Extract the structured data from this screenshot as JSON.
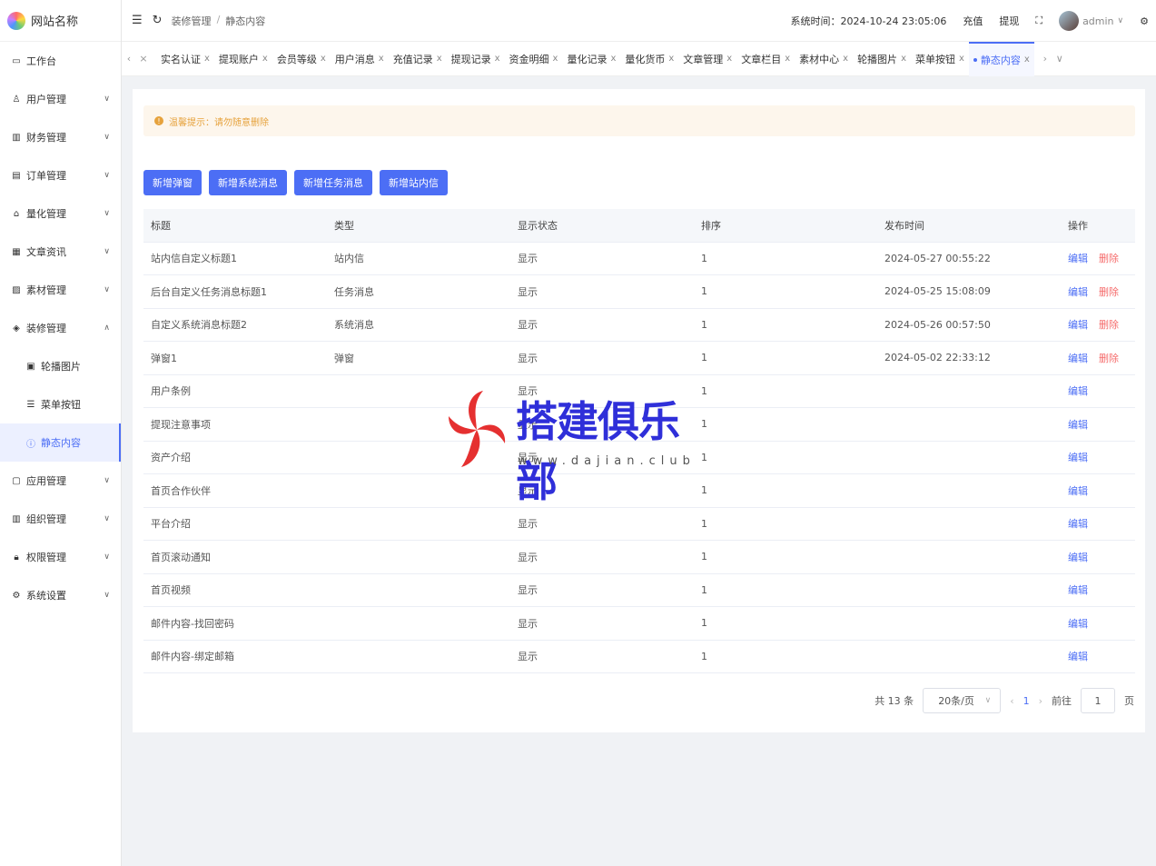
{
  "sidebar": {
    "site_name": "网站名称",
    "items": [
      {
        "label": "工作台",
        "icon": "monitor-icon"
      },
      {
        "label": "用户管理",
        "icon": "user-icon"
      },
      {
        "label": "财务管理",
        "icon": "chart-icon"
      },
      {
        "label": "订单管理",
        "icon": "order-icon"
      },
      {
        "label": "量化管理",
        "icon": "quant-icon"
      },
      {
        "label": "文章资讯",
        "icon": "article-icon"
      },
      {
        "label": "素材管理",
        "icon": "image-icon"
      },
      {
        "label": "装修管理",
        "icon": "decor-icon"
      },
      {
        "label": "轮播图片",
        "icon": "picture-icon"
      },
      {
        "label": "菜单按钮",
        "icon": "list-icon"
      },
      {
        "label": "静态内容",
        "icon": "info-icon"
      },
      {
        "label": "应用管理",
        "icon": "app-icon"
      },
      {
        "label": "组织管理",
        "icon": "org-icon"
      },
      {
        "label": "权限管理",
        "icon": "lock-icon"
      },
      {
        "label": "系统设置",
        "icon": "gear-icon"
      }
    ]
  },
  "header": {
    "breadcrumb_1": "装修管理",
    "breadcrumb_sep": "/",
    "breadcrumb_2": "静态内容",
    "system_time": "系统时间：2024-10-24 23:05:06",
    "recharge": "充值",
    "withdraw": "提现",
    "username": "admin"
  },
  "tabs": [
    "实名认证",
    "提现账户",
    "会员等级",
    "用户消息",
    "充值记录",
    "提现记录",
    "资金明细",
    "量化记录",
    "量化货币",
    "文章管理",
    "文章栏目",
    "素材中心",
    "轮播图片",
    "菜单按钮",
    "静态内容"
  ],
  "tab_close": "x",
  "notice": "温馨提示：请勿随意删除",
  "buttons": {
    "add_popup": "新增弹窗",
    "add_system": "新增系统消息",
    "add_task": "新增任务消息",
    "add_inbox": "新增站内信"
  },
  "table": {
    "headers": [
      "标题",
      "类型",
      "显示状态",
      "排序",
      "发布时间",
      "操作"
    ],
    "edit_label": "编辑",
    "delete_label": "删除",
    "rows": [
      {
        "title": "站内信自定义标题1",
        "type": "站内信",
        "status": "显示",
        "sort": "1",
        "time": "2024-05-27 00:55:22",
        "deletable": true
      },
      {
        "title": "后台自定义任务消息标题1",
        "type": "任务消息",
        "status": "显示",
        "sort": "1",
        "time": "2024-05-25 15:08:09",
        "deletable": true
      },
      {
        "title": "自定义系统消息标题2",
        "type": "系统消息",
        "status": "显示",
        "sort": "1",
        "time": "2024-05-26 00:57:50",
        "deletable": true
      },
      {
        "title": "弹窗1",
        "type": "弹窗",
        "status": "显示",
        "sort": "1",
        "time": "2024-05-02 22:33:12",
        "deletable": true
      },
      {
        "title": "用户条例",
        "type": "",
        "status": "显示",
        "sort": "1",
        "time": "",
        "deletable": false
      },
      {
        "title": "提现注意事项",
        "type": "",
        "status": "显示",
        "sort": "1",
        "time": "",
        "deletable": false
      },
      {
        "title": "资产介绍",
        "type": "",
        "status": "显示",
        "sort": "1",
        "time": "",
        "deletable": false
      },
      {
        "title": "首页合作伙伴",
        "type": "",
        "status": "显示",
        "sort": "1",
        "time": "",
        "deletable": false
      },
      {
        "title": "平台介绍",
        "type": "",
        "status": "显示",
        "sort": "1",
        "time": "",
        "deletable": false
      },
      {
        "title": "首页滚动通知",
        "type": "",
        "status": "显示",
        "sort": "1",
        "time": "",
        "deletable": false
      },
      {
        "title": "首页视频",
        "type": "",
        "status": "显示",
        "sort": "1",
        "time": "",
        "deletable": false
      },
      {
        "title": "邮件内容-找回密码",
        "type": "",
        "status": "显示",
        "sort": "1",
        "time": "",
        "deletable": false
      },
      {
        "title": "邮件内容-绑定邮箱",
        "type": "",
        "status": "显示",
        "sort": "1",
        "time": "",
        "deletable": false
      }
    ]
  },
  "pagination": {
    "total": "共 13 条",
    "page_size": "20条/页",
    "current": "1",
    "goto_label": "前往",
    "goto_value": "1",
    "page_suffix": "页"
  },
  "watermark": {
    "text": "搭建俱乐部",
    "url": "www.dajian.club"
  },
  "colors": {
    "primary": "#4c6ef5",
    "danger": "#f56c6c",
    "warning": "#e6a23c"
  }
}
